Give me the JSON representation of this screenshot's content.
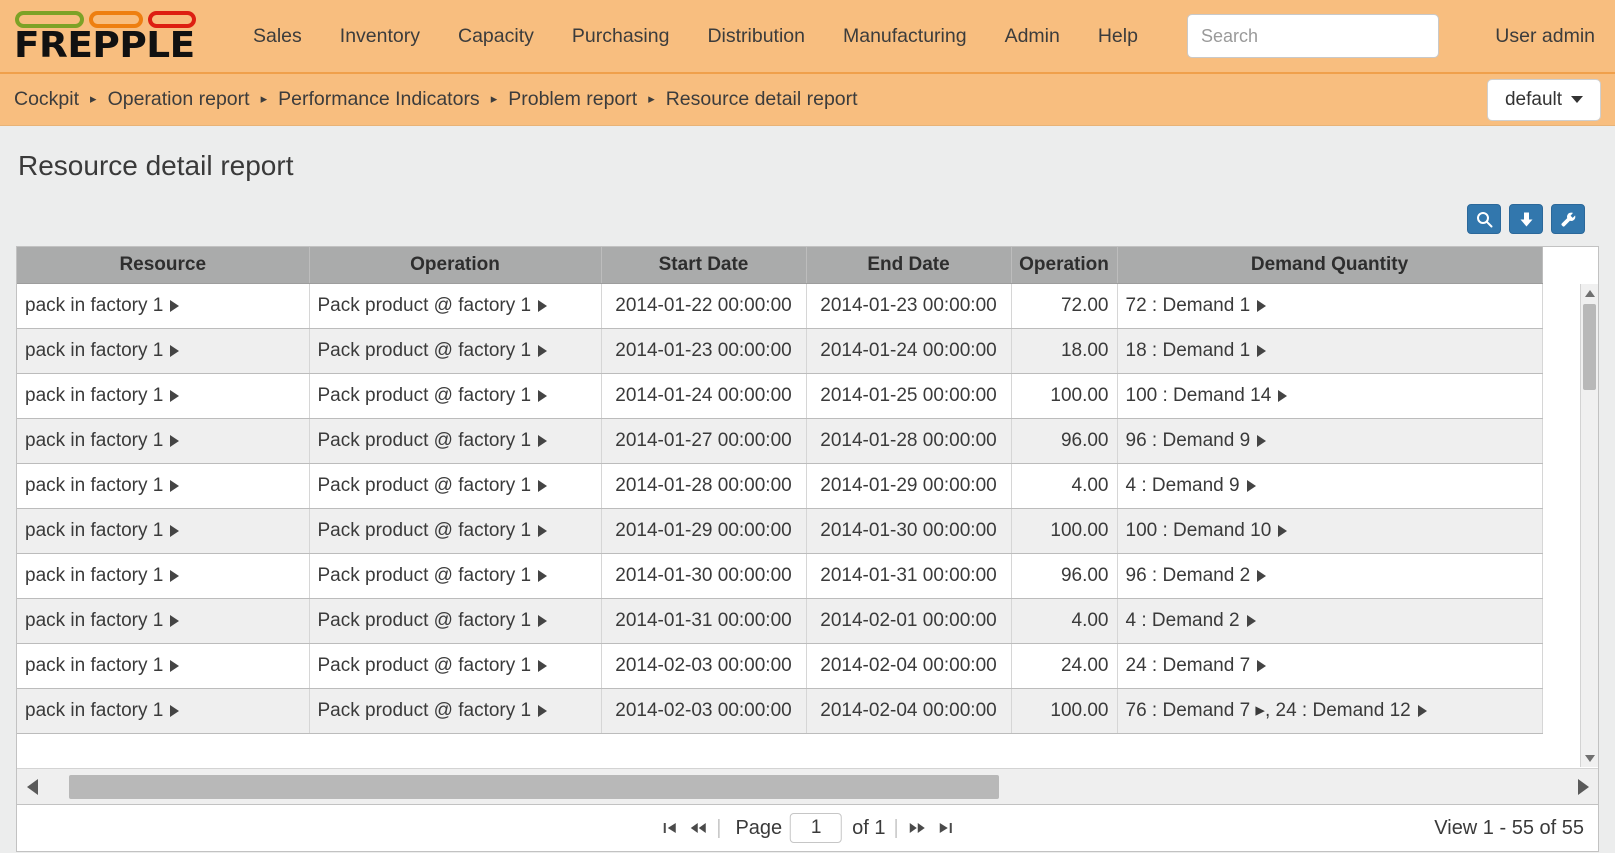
{
  "app": {
    "brand": "FREPPLE",
    "logo_pill_colors": [
      "#7ca226",
      "#ee7f10",
      "#dd1f12"
    ],
    "accent_bar": "#f8be7f",
    "button_blue": "#3277ad"
  },
  "nav": {
    "items": [
      {
        "label": "Sales"
      },
      {
        "label": "Inventory"
      },
      {
        "label": "Capacity"
      },
      {
        "label": "Purchasing"
      },
      {
        "label": "Distribution"
      },
      {
        "label": "Manufacturing"
      },
      {
        "label": "Admin"
      },
      {
        "label": "Help"
      }
    ],
    "search": {
      "value": "",
      "placeholder": "Search"
    },
    "user": "User admin"
  },
  "breadcrumb": {
    "items": [
      {
        "label": "Cockpit"
      },
      {
        "label": "Operation report"
      },
      {
        "label": "Performance Indicators"
      },
      {
        "label": "Problem report"
      },
      {
        "label": "Resource detail report"
      }
    ],
    "separator": "▸",
    "scenario_selector": "default"
  },
  "page": {
    "title": "Resource detail report"
  },
  "toolbar": {
    "buttons": [
      {
        "name": "search-filter-button",
        "icon": "magnifier-icon",
        "label": ""
      },
      {
        "name": "download-button",
        "icon": "download-arrow-icon",
        "label": ""
      },
      {
        "name": "settings-button",
        "icon": "wrench-icon",
        "label": ""
      }
    ]
  },
  "grid": {
    "columns": [
      {
        "key": "resource",
        "label": "Resource",
        "align": "l"
      },
      {
        "key": "operation",
        "label": "Operation",
        "align": "l"
      },
      {
        "key": "start_date",
        "label": "Start Date",
        "align": "c"
      },
      {
        "key": "end_date",
        "label": "End Date",
        "align": "c"
      },
      {
        "key": "operation_quantity",
        "label": "Operation",
        "align": "r"
      },
      {
        "key": "demand_quantity",
        "label": "Demand Quantity",
        "align": "l"
      }
    ],
    "rows": [
      {
        "resource": "pack in factory 1",
        "operation": "Pack product @ factory 1",
        "start_date": "2014-01-22 00:00:00",
        "end_date": "2014-01-23 00:00:00",
        "operation_quantity": "72.00",
        "demand_quantity": "72 : Demand 1"
      },
      {
        "resource": "pack in factory 1",
        "operation": "Pack product @ factory 1",
        "start_date": "2014-01-23 00:00:00",
        "end_date": "2014-01-24 00:00:00",
        "operation_quantity": "18.00",
        "demand_quantity": "18 : Demand 1"
      },
      {
        "resource": "pack in factory 1",
        "operation": "Pack product @ factory 1",
        "start_date": "2014-01-24 00:00:00",
        "end_date": "2014-01-25 00:00:00",
        "operation_quantity": "100.00",
        "demand_quantity": "100 : Demand 14"
      },
      {
        "resource": "pack in factory 1",
        "operation": "Pack product @ factory 1",
        "start_date": "2014-01-27 00:00:00",
        "end_date": "2014-01-28 00:00:00",
        "operation_quantity": "96.00",
        "demand_quantity": "96 : Demand 9"
      },
      {
        "resource": "pack in factory 1",
        "operation": "Pack product @ factory 1",
        "start_date": "2014-01-28 00:00:00",
        "end_date": "2014-01-29 00:00:00",
        "operation_quantity": "4.00",
        "demand_quantity": "4 : Demand 9"
      },
      {
        "resource": "pack in factory 1",
        "operation": "Pack product @ factory 1",
        "start_date": "2014-01-29 00:00:00",
        "end_date": "2014-01-30 00:00:00",
        "operation_quantity": "100.00",
        "demand_quantity": "100 : Demand 10"
      },
      {
        "resource": "pack in factory 1",
        "operation": "Pack product @ factory 1",
        "start_date": "2014-01-30 00:00:00",
        "end_date": "2014-01-31 00:00:00",
        "operation_quantity": "96.00",
        "demand_quantity": "96 : Demand 2"
      },
      {
        "resource": "pack in factory 1",
        "operation": "Pack product @ factory 1",
        "start_date": "2014-01-31 00:00:00",
        "end_date": "2014-02-01 00:00:00",
        "operation_quantity": "4.00",
        "demand_quantity": "4 : Demand 2"
      },
      {
        "resource": "pack in factory 1",
        "operation": "Pack product @ factory 1",
        "start_date": "2014-02-03 00:00:00",
        "end_date": "2014-02-04 00:00:00",
        "operation_quantity": "24.00",
        "demand_quantity": "24 : Demand 7"
      },
      {
        "resource": "pack in factory 1",
        "operation": "Pack product @ factory 1",
        "start_date": "2014-02-03 00:00:00",
        "end_date": "2014-02-04 00:00:00",
        "operation_quantity": "100.00",
        "demand_quantity": "76 : Demand 7 ▸, 24 : Demand 12"
      }
    ]
  },
  "pager": {
    "first_label": "⧉",
    "page_label": "Page",
    "page_value": "1",
    "of_label": "of 1",
    "view_status": "View 1 - 55 of 55"
  }
}
